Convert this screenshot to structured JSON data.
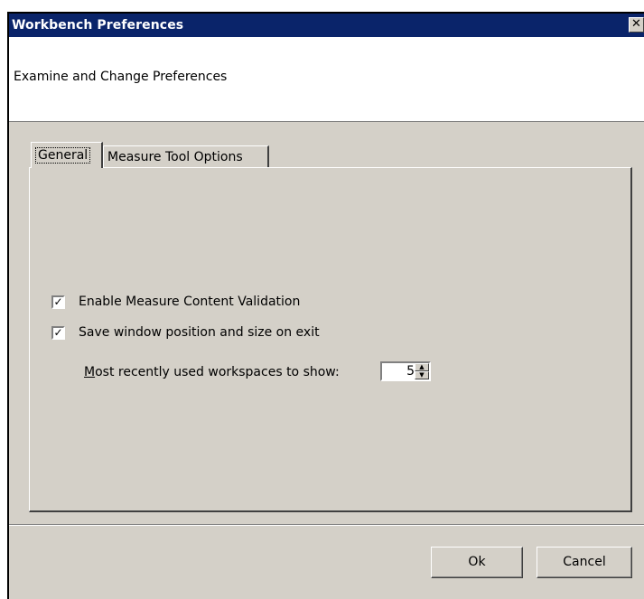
{
  "window": {
    "title": "Workbench Preferences",
    "close_glyph": "✕"
  },
  "header": {
    "description": "Examine and Change Preferences"
  },
  "tabs": [
    {
      "label": "General",
      "selected": true
    },
    {
      "label": "Measure Tool Options",
      "selected": false
    }
  ],
  "general": {
    "options": [
      {
        "label": "Enable Measure Content Validation",
        "checked": true,
        "check_glyph": "✓"
      },
      {
        "label": "Save window position and size on exit",
        "checked": true,
        "check_glyph": "✓"
      }
    ],
    "mru": {
      "label_accel": "M",
      "label_rest": "ost recently used workspaces to show:",
      "value": "5",
      "up_glyph": "▲",
      "down_glyph": "▼"
    }
  },
  "buttons": {
    "ok": "Ok",
    "cancel": "Cancel"
  },
  "colors": {
    "titlebar": "#0a246a",
    "face": "#d4d0c8",
    "header_bg": "#ffffff"
  }
}
